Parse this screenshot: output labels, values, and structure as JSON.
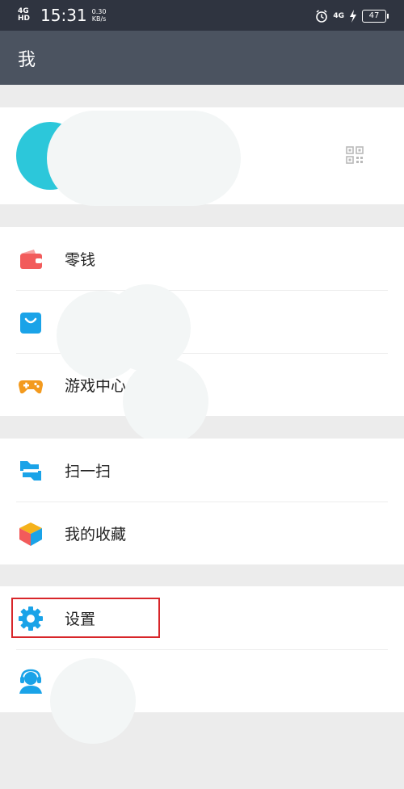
{
  "status_bar": {
    "network": "4G HD",
    "time": "15:31",
    "speed_value": "0.30",
    "speed_unit": "KB/s",
    "signal_right": "4G",
    "battery": "47"
  },
  "header": {
    "title": "我"
  },
  "menu": {
    "section1": [
      {
        "label": "零钱",
        "icon": "wallet-icon"
      },
      {
        "label": "",
        "icon": "shopping-bag-icon"
      },
      {
        "label": "游戏中心",
        "icon": "gamepad-icon"
      }
    ],
    "section2": [
      {
        "label": "扫一扫",
        "icon": "scan-icon"
      },
      {
        "label": "我的收藏",
        "icon": "collection-cube-icon"
      }
    ],
    "section3": [
      {
        "label": "设置",
        "icon": "gear-icon"
      },
      {
        "label": "",
        "icon": "customer-service-icon"
      }
    ]
  },
  "colors": {
    "accent_blue": "#1aa3e8",
    "wallet_red": "#f25b5b",
    "game_orange": "#f39a1e",
    "highlight_red": "#d8262a",
    "title_bar": "#4b5360",
    "status_bar": "#2f3440"
  }
}
